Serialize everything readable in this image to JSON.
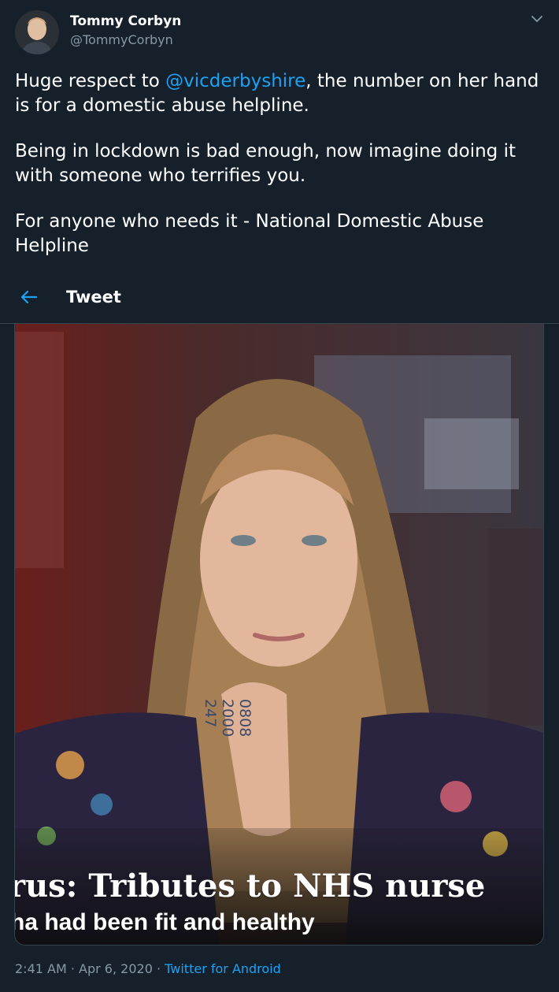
{
  "author": {
    "display_name": "Tommy Corbyn",
    "handle": "@TommyCorbyn"
  },
  "tweet": {
    "line1_before": "Huge respect to ",
    "mention": "@vicderbyshire",
    "line1_after": ", the number on her hand is for a domestic abuse helpline.",
    "paragraph2": "Being in lockdown is bad enough, now imagine doing it with someone who terrifies you.",
    "paragraph3": "For anyone who needs it - National Domestic Abuse Helpline"
  },
  "header": {
    "title": "Tweet"
  },
  "media": {
    "caption_line1": "rus: Tributes to NHS nurse",
    "caption_line2": "ha had been fit and healthy",
    "hand_number": "0808\n2000\n247"
  },
  "meta": {
    "time": "2:41 AM",
    "sep1": " · ",
    "date": "Apr 6, 2020",
    "sep2": " · ",
    "source": "Twitter for Android"
  },
  "icons": {
    "chevron": "chevron-down-icon",
    "back": "back-arrow-icon"
  },
  "colors": {
    "background": "#15202b",
    "accent": "#1da1f2",
    "muted": "#8899a6"
  }
}
